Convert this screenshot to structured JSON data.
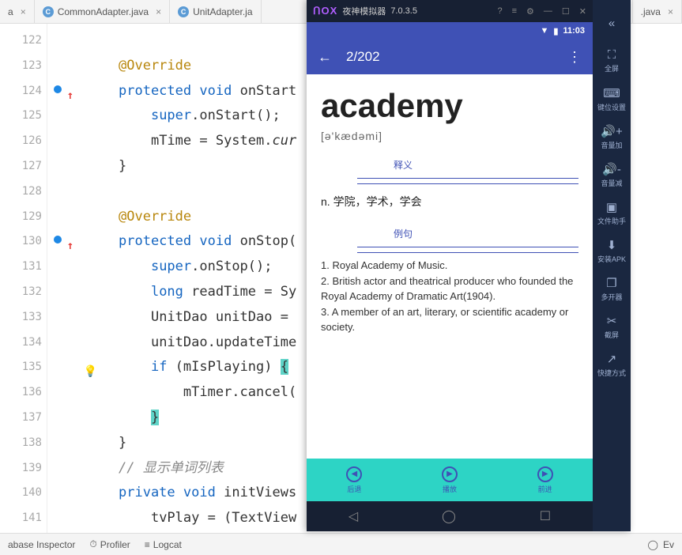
{
  "tabs": {
    "left_frag": "a",
    "t1": "CommonAdapter.java",
    "t2": "UnitAdapter.ja",
    "right_frag": ".java"
  },
  "gutter": [
    "122",
    "123",
    "124",
    "125",
    "126",
    "127",
    "128",
    "129",
    "130",
    "131",
    "132",
    "133",
    "134",
    "135",
    "136",
    "137",
    "138",
    "139",
    "140",
    "141"
  ],
  "code": {
    "l1": "",
    "l2": "@Override",
    "l3a": "protected",
    "l3b": "void",
    "l3c": "onStart",
    "l4a": "super",
    "l4b": ".onStart();",
    "l5a": "mTime = System.",
    "l5b": "cur",
    "l6": "}",
    "l7": "",
    "l8": "@Override",
    "l9a": "protected",
    "l9b": "void",
    "l9c": "onStop(",
    "l10a": "super",
    "l10b": ".onStop();",
    "l11a": "long",
    "l11b": "readTime = Sy",
    "l12": "UnitDao unitDao = ",
    "l13": "unitDao.updateTime",
    "l14a": "if",
    "l14b": "(mIsPlaying)",
    "l14c": "{",
    "l15": "mTimer.cancel(",
    "l16": "}",
    "l17": "}",
    "l18": "// 显示单词列表",
    "l19a": "private",
    "l19b": "void",
    "l19c": "initViews",
    "l20": "tvPlay = (TextView"
  },
  "bottom": {
    "db": "abase Inspector",
    "profiler": "Profiler",
    "logcat": "Logcat",
    "ev": "Ev"
  },
  "emulator": {
    "title_app": "夜神模拟器",
    "title_ver": "7.0.3.5",
    "status_time": "11:03",
    "appbar": {
      "counter": "2/202"
    },
    "word": "academy",
    "phonetic": "[ə'kædəmi]",
    "sec1": "释义",
    "definition": "n. 学院，学术，学会",
    "sec2": "例句",
    "ex1": "1. Royal Academy of Music.",
    "ex2": "2. British actor and theatrical producer who founded the Royal Academy of Dramatic Art(1904).",
    "ex3": "3. A member of an art, literary, or scientific academy or society.",
    "bottom_btns": {
      "prev": "后退",
      "play": "播放",
      "next": "前进"
    },
    "side": {
      "collapse": "«",
      "fullscreen": "全屏",
      "keymap": "键位设置",
      "volup": "音量加",
      "voldown": "音量减",
      "filehelper": "文件助手",
      "apk": "安装APK",
      "multi": "多开器",
      "shot": "截屏",
      "shortcut": "快捷方式"
    }
  }
}
